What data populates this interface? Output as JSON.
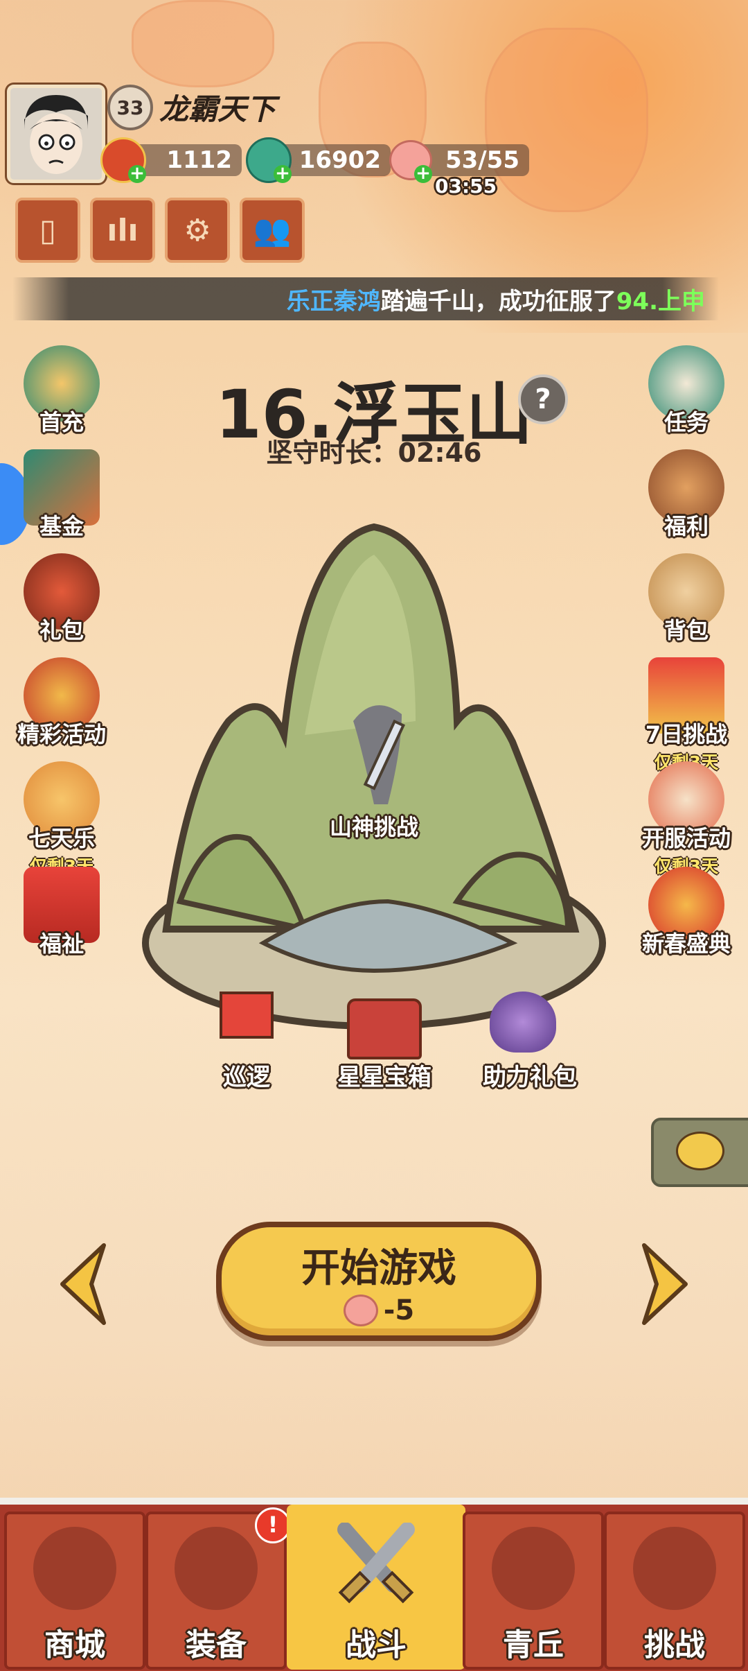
{
  "player": {
    "level": "33",
    "name": "龙霸天下"
  },
  "resources": {
    "gold": "1112",
    "jade": "16902",
    "stamina": "53/55",
    "stamina_timer": "03:55"
  },
  "ticker": {
    "name": "乐正秦鸿",
    "text": "踏遍千山，成功征服了",
    "target": "94.上申"
  },
  "stage": {
    "title": "16.浮玉山",
    "help_icon": "?",
    "hold_label": "坚守时长：02:46",
    "boss_label": "山神挑战"
  },
  "left_menu": [
    {
      "label": "首充",
      "sub": ""
    },
    {
      "label": "基金",
      "sub": ""
    },
    {
      "label": "礼包",
      "sub": ""
    },
    {
      "label": "精彩活动",
      "sub": ""
    },
    {
      "label": "七天乐",
      "sub": "仅剩3天"
    },
    {
      "label": "福祉",
      "sub": ""
    }
  ],
  "right_menu": [
    {
      "label": "任务",
      "sub": ""
    },
    {
      "label": "福利",
      "sub": ""
    },
    {
      "label": "背包",
      "sub": ""
    },
    {
      "label": "7日挑战",
      "sub": "仅剩3天"
    },
    {
      "label": "开服活动",
      "sub": "仅剩3天"
    },
    {
      "label": "新春盛典",
      "sub": ""
    }
  ],
  "map_items": [
    {
      "label": "巡逻"
    },
    {
      "label": "星星宝箱"
    },
    {
      "label": "助力礼包"
    }
  ],
  "start": {
    "label": "开始游戏",
    "cost": "-5"
  },
  "nav": [
    {
      "label": "商城"
    },
    {
      "label": "装备",
      "badge": "!"
    },
    {
      "label": "战斗"
    },
    {
      "label": "青丘"
    },
    {
      "label": "挑战"
    }
  ],
  "colors": {
    "accent": "#f5c94f",
    "nav_bg": "#a8392a",
    "ticker_name": "#4fb7ff",
    "ticker_target": "#7dff5a"
  }
}
